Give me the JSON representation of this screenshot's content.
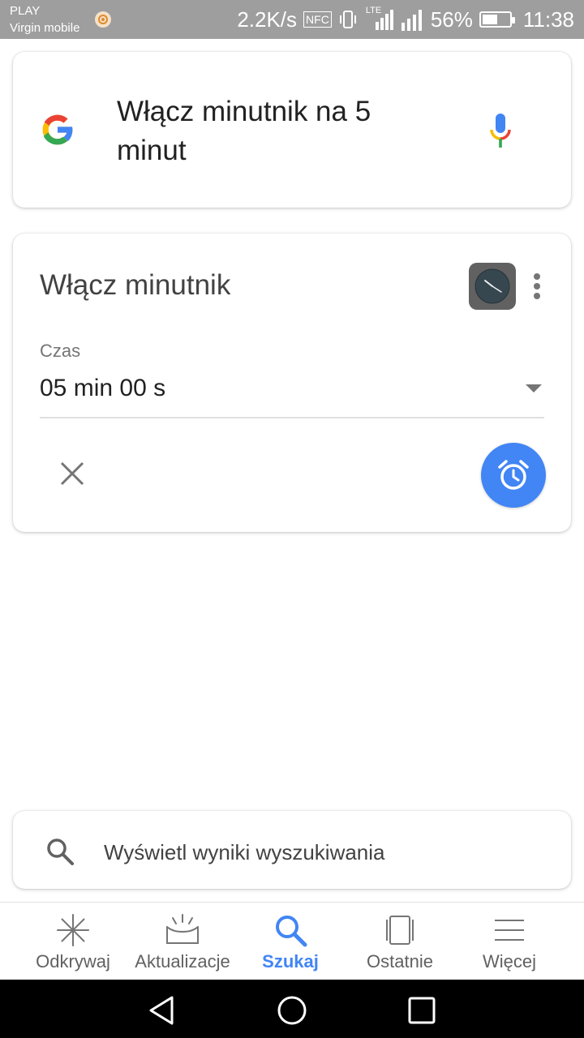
{
  "status_bar": {
    "carrier": "PLAY",
    "carrier_sub": "Virgin mobile",
    "speed": "2.2K/s",
    "nfc": "NFC",
    "network": "LTE",
    "battery_percent": "56%",
    "battery_level": 0.56,
    "time": "11:38",
    "icons": [
      "sun-icon",
      "nfc-icon",
      "vibrate-icon",
      "lte-signal-icon",
      "signal-icon",
      "battery-icon"
    ]
  },
  "query_card": {
    "query": "Włącz minutnik na 5 minut",
    "icons": [
      "google-logo-icon",
      "microphone-icon"
    ]
  },
  "timer_card": {
    "title": "Włącz minutnik",
    "field_label": "Czas",
    "field_value": "05 min 00 s",
    "icons": [
      "clock-app-icon",
      "more-vert-icon",
      "dropdown-arrow-icon",
      "close-icon",
      "alarm-icon"
    ]
  },
  "search_card": {
    "label": "Wyświetl wyniki wyszukiwania",
    "icon": "search-icon"
  },
  "bottom_nav": {
    "items": [
      {
        "label": "Odkrywaj",
        "icon": "discover-icon"
      },
      {
        "label": "Aktualizacje",
        "icon": "updates-icon"
      },
      {
        "label": "Szukaj",
        "icon": "search-icon",
        "active": true
      },
      {
        "label": "Ostatnie",
        "icon": "recents-icon"
      },
      {
        "label": "Więcej",
        "icon": "menu-icon"
      }
    ]
  },
  "system_nav": [
    "back-icon",
    "home-icon",
    "overview-icon"
  ],
  "colors": {
    "accent": "#4285f4",
    "status_bar": "#9e9e9e",
    "google_red": "#ea4335",
    "google_yellow": "#fbbc05",
    "google_green": "#34a853"
  }
}
